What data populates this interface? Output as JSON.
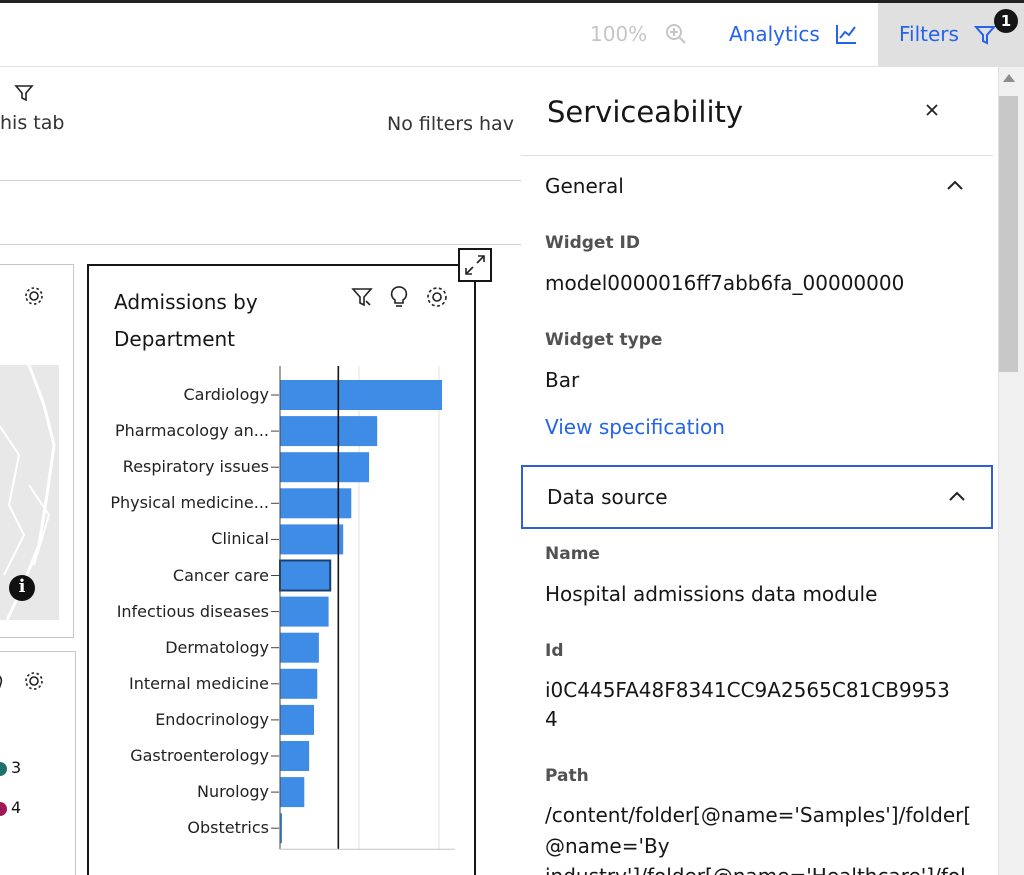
{
  "toolbar": {
    "zoom": "100%",
    "analytics_label": "Analytics",
    "filters_label": "Filters",
    "filters_badge": "1"
  },
  "canvas": {
    "tab_filter_text": "his tab",
    "no_filters_text": "No filters hav",
    "legend_values": [
      "3",
      "4"
    ],
    "widget": {
      "title_line1": "Admissions by",
      "title_line2": "Department"
    }
  },
  "chart_data": {
    "type": "bar",
    "orientation": "horizontal",
    "title": "Admissions by Department",
    "categories": [
      "Cardiology",
      "Pharmacology an...",
      "Respiratory issues",
      "Physical medicine...",
      "Clinical",
      "Cancer care",
      "Infectious diseases",
      "Dermatology",
      "Internal medicine",
      "Endocrinology",
      "Gastroenterology",
      "Nurology",
      "Obstetrics"
    ],
    "values": [
      100,
      60,
      55,
      44,
      39,
      31,
      30,
      24,
      23,
      21,
      18,
      15,
      1
    ],
    "average_line": 36,
    "selected_category": "Cancer care",
    "bar_color": "#3f8ce6",
    "grid": true
  },
  "panel": {
    "title": "Serviceability",
    "general": {
      "heading": "General",
      "widget_id_label": "Widget ID",
      "widget_id": "model0000016ff7abb6fa_00000000",
      "widget_type_label": "Widget type",
      "widget_type": "Bar",
      "view_spec": "View specification"
    },
    "data_source": {
      "heading": "Data source",
      "name_label": "Name",
      "name": "Hospital admissions data module",
      "id_label": "Id",
      "id_line1": "i0C445FA48F8341CC9A2565C81CB9953",
      "id_line2": "4",
      "path_label": "Path",
      "path_line1": "/content/folder[@name='Samples']/folder[",
      "path_line2": "@name='By",
      "path_line3": "industry']/folder[@name='Healthcare']/fol"
    }
  },
  "colors": {
    "accent": "#2563eb",
    "focus_border": "#2f5fd0",
    "legend_teal": "#1f6f6b",
    "legend_magenta": "#9f1853"
  }
}
